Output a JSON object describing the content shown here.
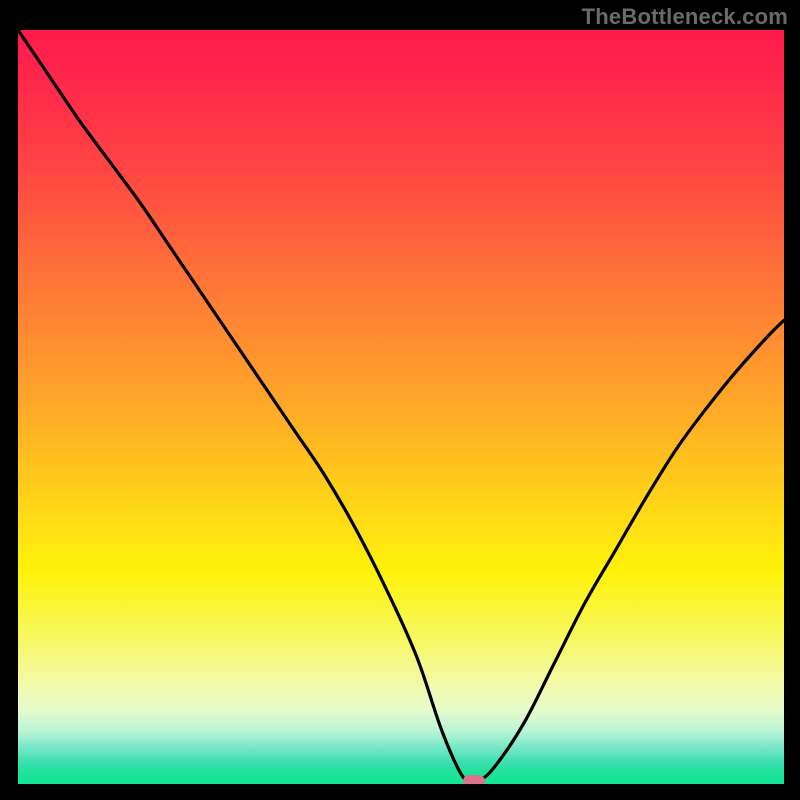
{
  "header": {
    "watermark": "TheBottleneck.com"
  },
  "colors": {
    "curve": "#000000",
    "marker": "#d9748a",
    "frame": "#000000"
  },
  "chart_data": {
    "type": "line",
    "title": "",
    "xlabel": "",
    "ylabel": "",
    "xlim": [
      0,
      100
    ],
    "ylim": [
      0,
      100
    ],
    "grid": false,
    "legend": false,
    "series": [
      {
        "name": "bottleneck-curve",
        "x": [
          0,
          4,
          8,
          12,
          16,
          20,
          24,
          28,
          32,
          36,
          40,
          44,
          48,
          52,
          55,
          57,
          58.5,
          60,
          62,
          66,
          70,
          74,
          78,
          82,
          86,
          90,
          94,
          98,
          100
        ],
        "y": [
          100,
          94,
          88,
          82.5,
          77,
          71,
          65,
          59,
          53,
          47,
          41,
          34,
          26,
          17,
          8,
          3,
          0.5,
          0.5,
          2,
          8,
          16,
          24,
          31,
          38,
          44.5,
          50,
          55,
          59.5,
          61.5
        ]
      }
    ],
    "minimum_marker": {
      "x": 59.5,
      "y": 0.4
    },
    "gradient_stops": [
      {
        "pos": 0.0,
        "color": "#ff1a4d"
      },
      {
        "pos": 0.3,
        "color": "#ff6a3a"
      },
      {
        "pos": 0.58,
        "color": "#ffc41d"
      },
      {
        "pos": 0.8,
        "color": "#f7f85a"
      },
      {
        "pos": 0.93,
        "color": "#b9f5d6"
      },
      {
        "pos": 1.0,
        "color": "#12e890"
      }
    ]
  }
}
